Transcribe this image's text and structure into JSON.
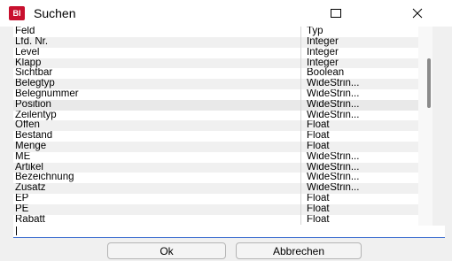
{
  "window": {
    "title": "Suchen",
    "app_icon_text": "BI",
    "maximize_glyph": "☐",
    "close_glyph": "✕"
  },
  "table": {
    "headers": {
      "feld": "Feld",
      "typ": "Typ"
    },
    "rows": [
      {
        "feld": "Lfd. Nr.",
        "typ": "Integer"
      },
      {
        "feld": "Level",
        "typ": "Integer"
      },
      {
        "feld": "Klapp",
        "typ": "Integer"
      },
      {
        "feld": "Sichtbar",
        "typ": "Boolean"
      },
      {
        "feld": "Belegtyp",
        "typ": "WideStrin..."
      },
      {
        "feld": "Belegnummer",
        "typ": "WideStrin..."
      },
      {
        "feld": "Position",
        "typ": "WideStrin..."
      },
      {
        "feld": "Zeilentyp",
        "typ": "WideStrin..."
      },
      {
        "feld": "Offen",
        "typ": "Float"
      },
      {
        "feld": "Bestand",
        "typ": "Float"
      },
      {
        "feld": "Menge",
        "typ": "Float"
      },
      {
        "feld": "ME",
        "typ": "WideStrin..."
      },
      {
        "feld": "Artikel",
        "typ": "WideStrin..."
      },
      {
        "feld": "Bezeichnung",
        "typ": "WideStrin..."
      },
      {
        "feld": "Zusatz",
        "typ": "WideStrin..."
      },
      {
        "feld": "EP",
        "typ": "Float"
      },
      {
        "feld": "PE",
        "typ": "Float"
      },
      {
        "feld": "Rabatt",
        "typ": "Float"
      }
    ],
    "selected_row": "Position"
  },
  "search": {
    "value": ""
  },
  "buttons": {
    "ok": "Ok",
    "cancel": "Abbrechen"
  },
  "colors": {
    "row_alt": "#f0f0f0",
    "row_selected": "#e9e9e9",
    "input_focus": "#3b6ccf",
    "app_icon": "#c8102e"
  }
}
